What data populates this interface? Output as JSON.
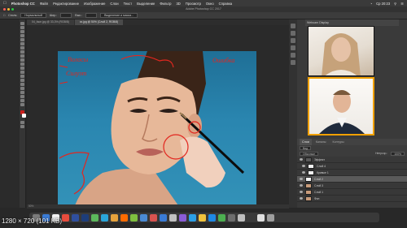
{
  "menubar": {
    "app_name": "Photoshop CC",
    "items": [
      "Файл",
      "Редактирование",
      "Изображение",
      "Слои",
      "Текст",
      "Выделение",
      "Фильтр",
      "3D",
      "Просмотр",
      "Окно",
      "Справка"
    ],
    "clock": "Ср 20:23"
  },
  "window": {
    "title": "Adobe Photoshop CC 2017"
  },
  "options": {
    "style_label": "Стиль:",
    "style_value": "Нормальный",
    "width_label": "Шир.:",
    "height_label": "Выс.:",
    "refine_button": "Выделение и маска..."
  },
  "document_tabs": [
    {
      "label": "04_face.jpg @ 33,3% (RGB/8)",
      "active": false
    },
    {
      "label": "xx.jpg @ 50% (Слой 2, RGB/8)",
      "active": true
    }
  ],
  "status": {
    "zoom": "50%"
  },
  "video_panel": {
    "title": "Webcam Display"
  },
  "layers_panel": {
    "tabs": [
      "Слои",
      "Каналы",
      "Контуры"
    ],
    "active_tab": "Слои",
    "kind_label": "Вид",
    "blend_mode": "Обычные",
    "opacity_label": "Непрозр.:",
    "opacity_value": "100%",
    "lock_label": "Закрепить:",
    "fill_label": "Заливка:",
    "fill_value": "100%",
    "layers": [
      {
        "name": "Эффект",
        "thumb": "d",
        "selected": false,
        "indent": false
      },
      {
        "name": "Слой 4",
        "thumb": "w",
        "selected": false,
        "indent": true
      },
      {
        "name": "Кривые 1",
        "thumb": "w",
        "selected": false,
        "indent": true
      },
      {
        "name": "Слой 2",
        "thumb": "w",
        "selected": true,
        "indent": false
      },
      {
        "name": "Слой 3",
        "thumb": "p",
        "selected": false,
        "indent": false
      },
      {
        "name": "Слой 1",
        "thumb": "p",
        "selected": false,
        "indent": false
      },
      {
        "name": "Фон",
        "thumb": "p",
        "selected": false,
        "indent": false
      }
    ]
  },
  "canvas": {
    "annotations": [
      "Волосы",
      "Ошибка",
      "Силуэт"
    ]
  },
  "dock": {
    "colors": [
      "#7a7a7a",
      "#3a7bd5",
      "#f2f2f2",
      "#e84c3d",
      "#2f4f9e",
      "#1d3d7a",
      "#5cb85c",
      "#2aa5d9",
      "#e6a23c",
      "#ff6b00",
      "#7fbf3f",
      "#4a8ad4",
      "#d9534f",
      "#3a7bd5",
      "#c0c0c0",
      "#8a5cd6",
      "#2b9fe6",
      "#f0c23c",
      "#1e88e5",
      "#4caf50",
      "#6d6d6d",
      "#bfbfbf",
      "#3a3a3a",
      "#e0e0e0",
      "#9e9e9e"
    ]
  },
  "overlay": {
    "resolution_info": "1280 × 720 (101 KB)"
  }
}
